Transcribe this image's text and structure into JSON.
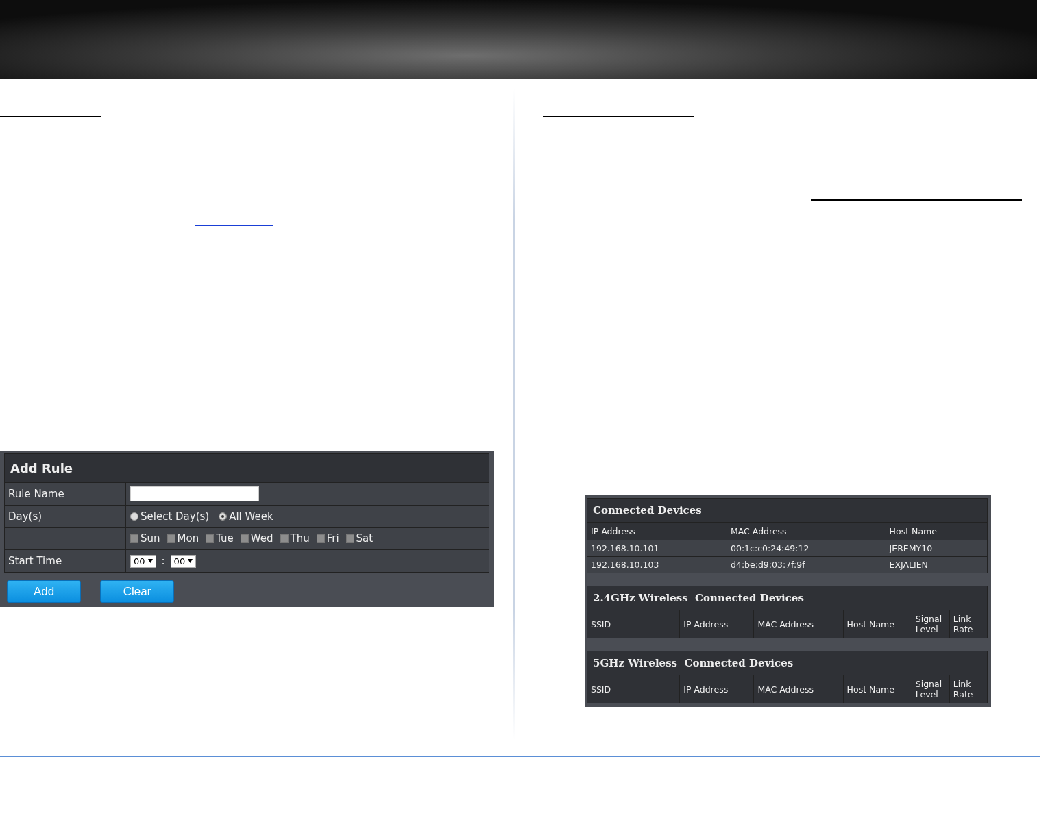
{
  "add_rule": {
    "title": "Add Rule",
    "rule_name": {
      "label": "Rule Name"
    },
    "days": {
      "label": "Day(s)",
      "options": [
        {
          "label": "Select Day(s)",
          "selected": false
        },
        {
          "label": "All Week",
          "selected": true
        }
      ],
      "weekdays": [
        {
          "label": "Sun",
          "checked": false,
          "disabled": true
        },
        {
          "label": "Mon",
          "checked": false,
          "disabled": true
        },
        {
          "label": "Tue",
          "checked": false,
          "disabled": true
        },
        {
          "label": "Wed",
          "checked": false,
          "disabled": true
        },
        {
          "label": "Thu",
          "checked": false,
          "disabled": true
        },
        {
          "label": "Fri",
          "checked": false,
          "disabled": true
        },
        {
          "label": "Sat",
          "checked": false,
          "disabled": true
        }
      ]
    },
    "start_time": {
      "label": "Start Time",
      "hour": "00",
      "separator": ":",
      "minute": "00"
    },
    "buttons": [
      "Add",
      "Clear"
    ]
  },
  "connected_devices": {
    "title": "Connected Devices",
    "columns": [
      "IP Address",
      "MAC Address",
      "Host Name"
    ],
    "rows": [
      [
        "192.168.10.101",
        "00:1c:c0:24:49:12",
        "JEREMY10"
      ],
      [
        "192.168.10.103",
        "d4:be:d9:03:7f:9f",
        "EXJALIEN"
      ]
    ]
  },
  "wireless_sections": [
    {
      "title": "2.4GHz Wireless  Connected Devices",
      "columns": [
        "SSID",
        "IP Address",
        "MAC Address",
        "Host Name",
        "Signal Level",
        "Link Rate"
      ]
    },
    {
      "title": "5GHz Wireless  Connected Devices",
      "columns": [
        "SSID",
        "IP Address",
        "MAC Address",
        "Host Name",
        "Signal Level",
        "Link Rate"
      ]
    }
  ]
}
